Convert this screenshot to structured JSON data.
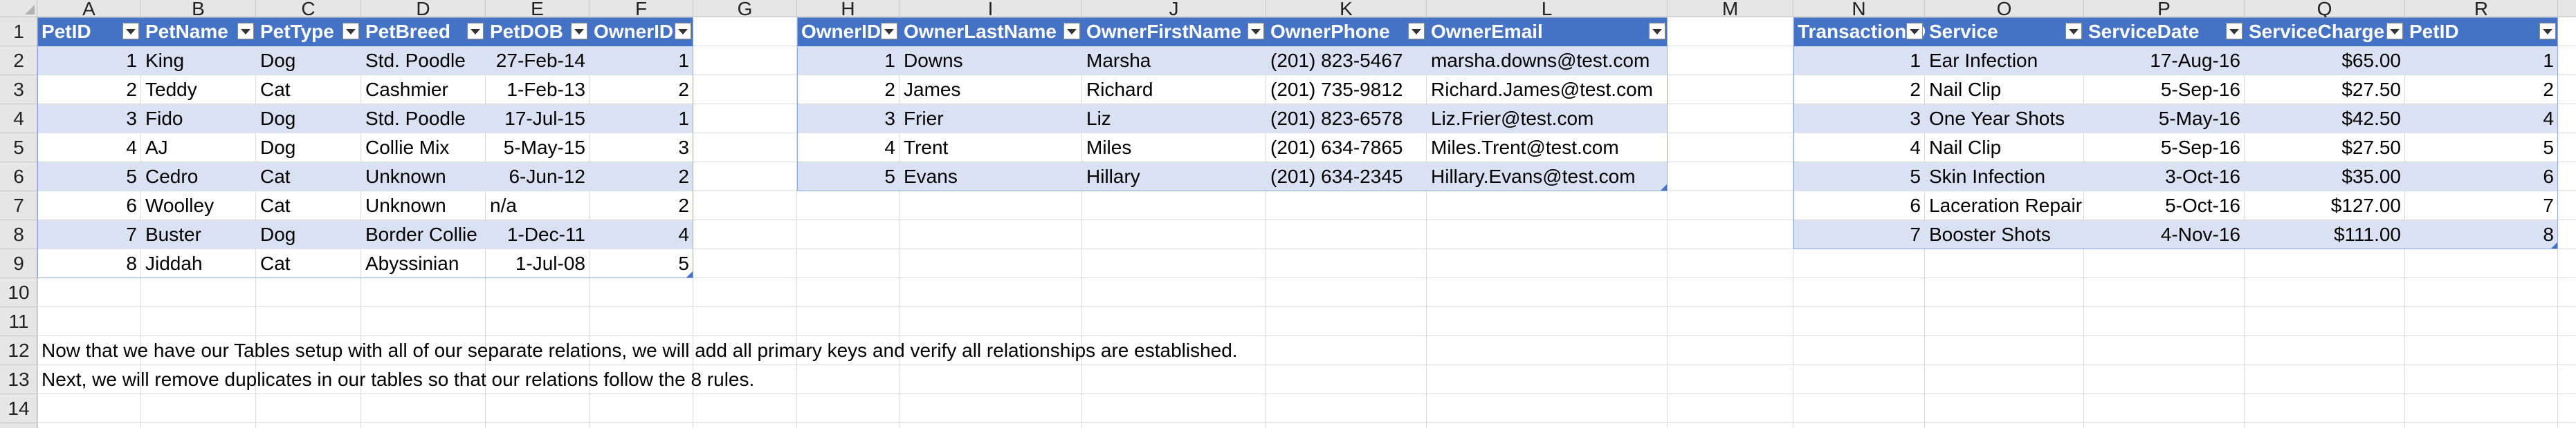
{
  "columns": [
    "A",
    "B",
    "C",
    "D",
    "E",
    "F",
    "G",
    "H",
    "I",
    "J",
    "K",
    "L",
    "M",
    "N",
    "O",
    "P",
    "Q",
    "R"
  ],
  "rows": [
    "1",
    "2",
    "3",
    "4",
    "5",
    "6",
    "7",
    "8",
    "9",
    "10",
    "11",
    "12",
    "13",
    "14"
  ],
  "pets_table": {
    "headers": [
      "PetID",
      "PetName",
      "PetType",
      "PetBreed",
      "PetDOB",
      "OwnerID"
    ],
    "rows": [
      [
        "1",
        "King",
        "Dog",
        "Std. Poodle",
        "27-Feb-14",
        "1"
      ],
      [
        "2",
        "Teddy",
        "Cat",
        "Cashmier",
        "1-Feb-13",
        "2"
      ],
      [
        "3",
        "Fido",
        "Dog",
        "Std. Poodle",
        "17-Jul-15",
        "1"
      ],
      [
        "4",
        "AJ",
        "Dog",
        "Collie Mix",
        "5-May-15",
        "3"
      ],
      [
        "5",
        "Cedro",
        "Cat",
        "Unknown",
        "6-Jun-12",
        "2"
      ],
      [
        "6",
        "Woolley",
        "Cat",
        "Unknown",
        "n/a",
        "2"
      ],
      [
        "7",
        "Buster",
        "Dog",
        "Border Collie",
        "1-Dec-11",
        "4"
      ],
      [
        "8",
        "Jiddah",
        "Cat",
        "Abyssinian",
        "1-Jul-08",
        "5"
      ]
    ]
  },
  "owners_table": {
    "headers": [
      "OwnerID",
      "OwnerLastName",
      "OwnerFirstName",
      "OwnerPhone",
      "OwnerEmail"
    ],
    "rows": [
      [
        "1",
        "Downs",
        "Marsha",
        "(201) 823-5467",
        "marsha.downs@test.com"
      ],
      [
        "2",
        "James",
        "Richard",
        "(201) 735-9812",
        "Richard.James@test.com"
      ],
      [
        "3",
        "Frier",
        "Liz",
        "(201) 823-6578",
        "Liz.Frier@test.com"
      ],
      [
        "4",
        "Trent",
        "Miles",
        "(201) 634-7865",
        "Miles.Trent@test.com"
      ],
      [
        "5",
        "Evans",
        "Hillary",
        "(201) 634-2345",
        "Hillary.Evans@test.com"
      ]
    ]
  },
  "services_table": {
    "headers": [
      "TransactionID",
      "Service",
      "ServiceDate",
      "ServiceCharge",
      "PetID"
    ],
    "rows": [
      [
        "1",
        "Ear Infection",
        "17-Aug-16",
        "$65.00",
        "1"
      ],
      [
        "2",
        "Nail Clip",
        "5-Sep-16",
        "$27.50",
        "2"
      ],
      [
        "3",
        "One Year Shots",
        "5-May-16",
        "$42.50",
        "4"
      ],
      [
        "4",
        "Nail Clip",
        "5-Sep-16",
        "$27.50",
        "5"
      ],
      [
        "5",
        "Skin Infection",
        "3-Oct-16",
        "$35.00",
        "6"
      ],
      [
        "6",
        "Laceration Repair",
        "5-Oct-16",
        "$127.00",
        "7"
      ],
      [
        "7",
        "Booster Shots",
        "4-Nov-16",
        "$111.00",
        "8"
      ]
    ]
  },
  "notes": {
    "line12": "Now that we have our Tables setup with all of our separate relations, we will add all primary keys and verify all relationships are established.",
    "line13": "Next, we will remove duplicates in our tables so that our relations follow the 8 rules."
  },
  "colors": {
    "header_fill": "#4472c4",
    "band_fill": "#d9e1f2",
    "grid_line": "#d9d9d9",
    "heading_bg": "#e6e6e6"
  }
}
